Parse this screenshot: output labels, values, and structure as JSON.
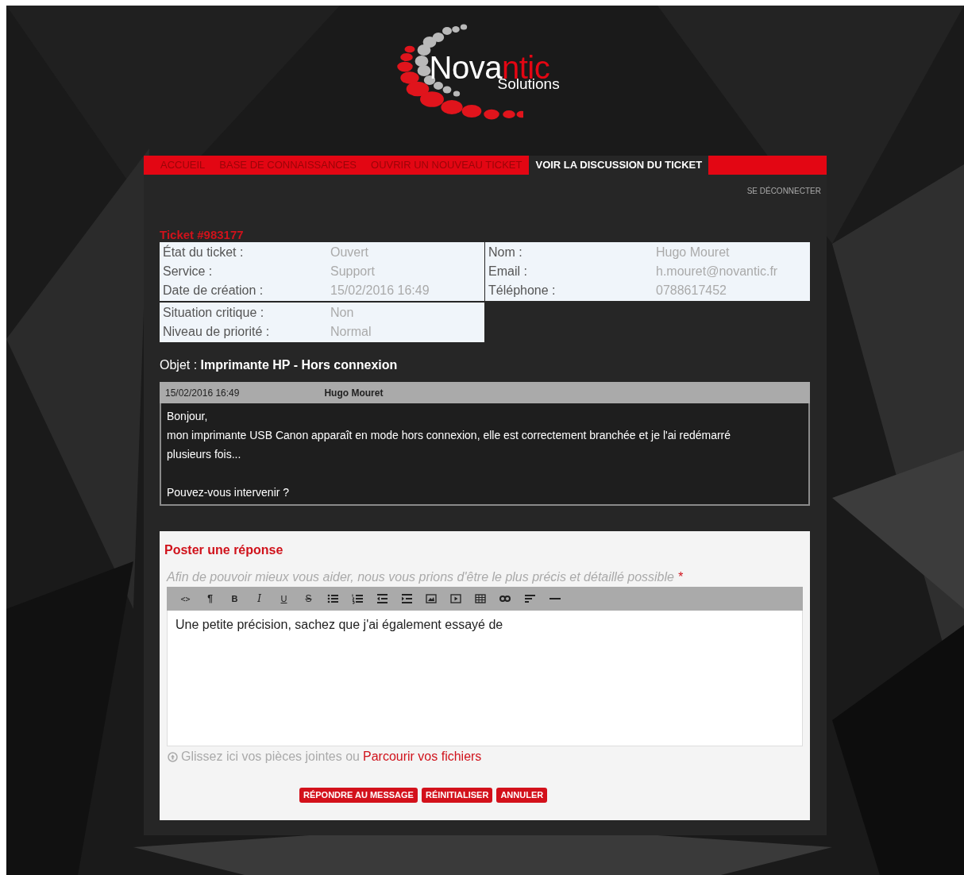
{
  "logo": {
    "name_start": "Nova",
    "name_end": "ntic",
    "tagline": "Solutions"
  },
  "tabs": [
    {
      "label": "ACCUEIL",
      "selected": false
    },
    {
      "label": "BASE DE CONNAISSANCES",
      "selected": false
    },
    {
      "label": "OUVRIR UN NOUVEAU TICKET",
      "selected": false
    },
    {
      "label": "VOIR LA DISCUSSION DU TICKET",
      "selected": true
    }
  ],
  "logout": "SE DÉCONNECTER",
  "ticket": {
    "title": "Ticket #983177",
    "info_groups": [
      {
        "rows": [
          {
            "label": "État du ticket :",
            "value": "Ouvert"
          },
          {
            "label": "Service :",
            "value": "Support"
          },
          {
            "label": "Date de création :",
            "value": "15/02/2016 16:49"
          }
        ]
      },
      {
        "rows": [
          {
            "label": "Nom :",
            "value": "Hugo Mouret"
          },
          {
            "label": "Email :",
            "value": "h.mouret@novantic.fr"
          },
          {
            "label": "Téléphone :",
            "value": "0788617452"
          }
        ]
      },
      {
        "rows": [
          {
            "label": "Situation critique :",
            "value": "Non"
          },
          {
            "label": "Niveau de priorité :",
            "value": "Normal"
          }
        ]
      }
    ],
    "subject": "Objet : **Imprimante HP - Hors connexion**"
  },
  "messages": [
    {
      "date": "15/02/2016 16:49",
      "author": "Hugo Mouret",
      "paragraphs": [
        [
          "Bonjour,",
          "mon imprimante USB Canon apparaît en mode hors connexion, elle est correctement branchée et je l'ai redémarré plusieurs fois..."
        ],
        [
          "Pouvez-vous intervenir ?"
        ]
      ]
    }
  ],
  "reply": {
    "title": "Poster une réponse",
    "hint": "Afin de pouvoir mieux vous aider, nous vous prions d'être le plus précis et détaillé possible",
    "required_mark": "*",
    "toolbar_glyphs": [
      "<>",
      "¶",
      "B",
      "I",
      "U",
      "S"
    ],
    "value": "Une petite précision, sachez que j'ai également essayé de",
    "attach_text": "Glissez ici vos pièces jointes ou",
    "attach_link": "Parcourir vos fichiers",
    "buttons": [
      "RÉPONDRE AU MESSAGE",
      "RÉINITIALISER",
      "ANNULER"
    ]
  }
}
